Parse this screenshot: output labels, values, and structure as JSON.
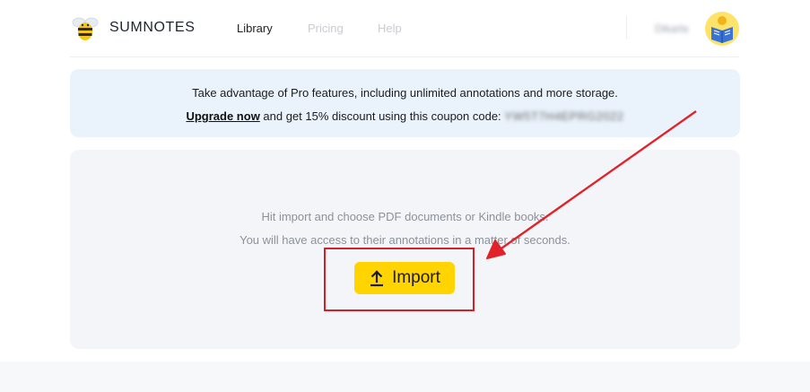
{
  "header": {
    "brand": "SUMNOTES",
    "nav": [
      {
        "label": "Library",
        "active": true
      },
      {
        "label": "Pricing",
        "active": false
      },
      {
        "label": "Help",
        "active": false
      }
    ],
    "username": "Dikarla",
    "logo_icon": "bee-icon",
    "avatar_icon": "reading-book-avatar"
  },
  "promo": {
    "line1": "Take advantage of Pro features, including unlimited annotations and more storage.",
    "upgrade_link": "Upgrade now",
    "line2_text": " and get 15% discount using this coupon code: ",
    "coupon_code": "YW5T7H4EPRG2022"
  },
  "import_panel": {
    "hint_line1": "Hit import and choose PDF documents or Kindle books.",
    "hint_line2": "You will have access to their annotations in a matter of seconds.",
    "import_button": "Import",
    "import_icon": "upload-icon"
  },
  "colors": {
    "accent_yellow": "#ffd400",
    "promo_bg": "#eaf3fc",
    "panel_bg": "#f4f5f8",
    "annotation_red": "#d4202a"
  }
}
